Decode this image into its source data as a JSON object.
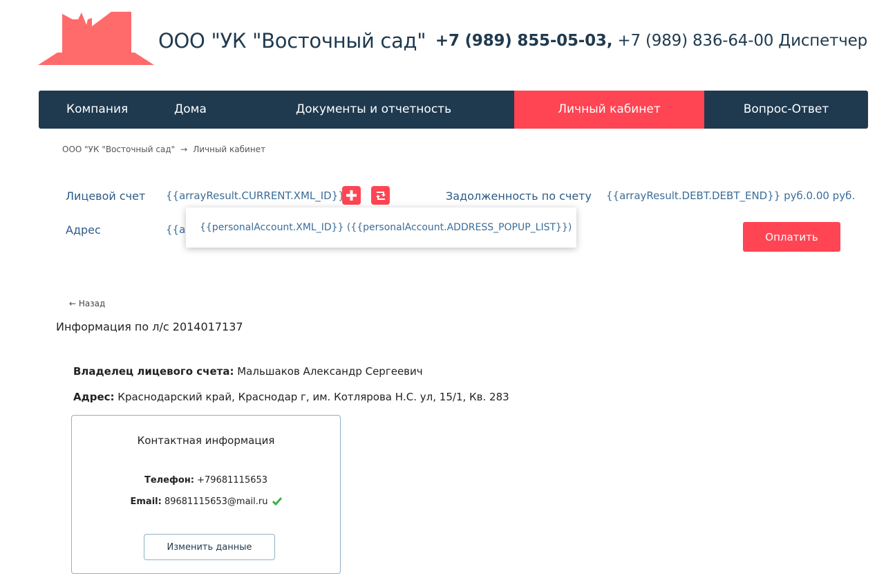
{
  "header": {
    "company_name": "ООО \"УК \"Восточный сад\"",
    "phone_main": "+7 (989) 855-05-03,",
    "phone_dispatcher": " +7 (989) 836-64-00 Диспетчер",
    "logo_color": "#ff6b6b"
  },
  "nav": {
    "items": [
      {
        "label": "Компания"
      },
      {
        "label": "Дома"
      },
      {
        "label": "Документы и отчетность"
      },
      {
        "label": "Личный кабинет"
      },
      {
        "label": "Вопрос-Ответ"
      }
    ],
    "active_index": 3,
    "bg_color": "#1f3a4f",
    "active_color": "#ff4453"
  },
  "breadcrumb": {
    "home": "ООО \"УК \"Восточный сад\"",
    "separator": "→",
    "current": "Личный кабинет"
  },
  "account": {
    "account_label": "Лицевой счет",
    "account_value": "{{arrayResult.CURRENT.XML_ID}}",
    "address_label": "Адрес",
    "address_value_partial": "{{arr",
    "debt_label": "Задолженность по счету",
    "debt_value": "{{arrayResult.DEBT.DEBT_END}} руб.0.00 руб.",
    "add_icon": "plus-icon",
    "switch_icon": "retweet-icon",
    "pay_button": "Оплатить"
  },
  "popup": {
    "text": "{{personalAccount.XML_ID}} ({{personalAccount.ADDRESS_POPUP_LIST}})"
  },
  "details": {
    "back_link": "← Назад",
    "title": "Информация по л/с 2014017137",
    "owner_label": "Владелец лицевого счета:",
    "owner_value": " Мальшаков Александр Сергеевич",
    "address_label": "Адрес:",
    "address_value": " Краснодарский край, Краснодар г, им. Котлярова Н.С. ул, 15/1, Кв. 283"
  },
  "contact": {
    "title": "Контактная информация",
    "phone_label": "Телефон:",
    "phone_value": " +79681115653",
    "email_label": "Email:",
    "email_value": " 89681115653@mail.ru",
    "verified_icon": "check-icon",
    "verified_color": "#3cb043",
    "edit_button": "Изменить данные"
  }
}
